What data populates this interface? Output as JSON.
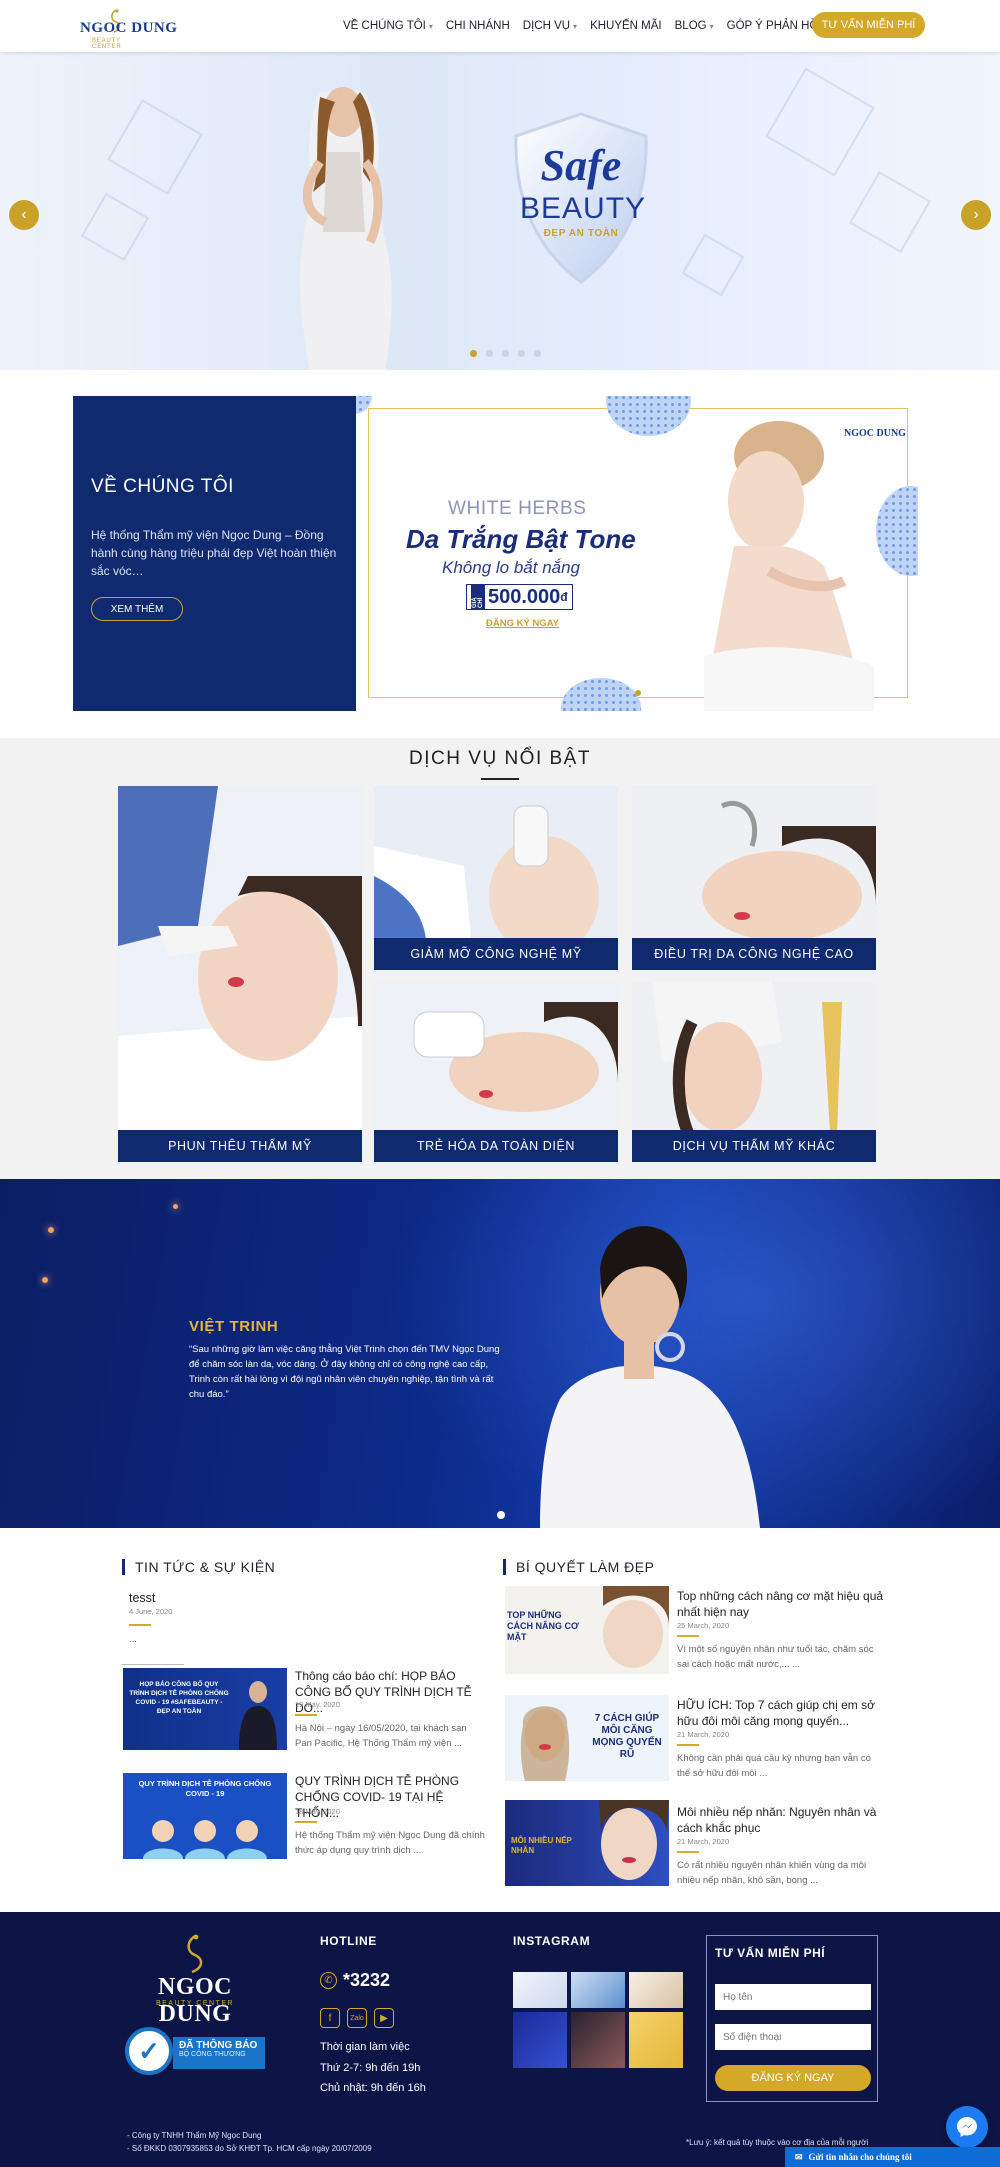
{
  "brand": {
    "logo_text": "NGOC DUNG",
    "logo_sub": "BEAUTY CENTER"
  },
  "nav": {
    "items": [
      {
        "label": "VỀ CHÚNG TÔI",
        "has_dropdown": true
      },
      {
        "label": "CHI NHÁNH",
        "has_dropdown": false
      },
      {
        "label": "DỊCH VỤ",
        "has_dropdown": true
      },
      {
        "label": "KHUYẾN MÃI",
        "has_dropdown": false
      },
      {
        "label": "BLOG",
        "has_dropdown": true
      },
      {
        "label": "GÓP Ý PHẢN HỒI",
        "has_dropdown": false
      }
    ],
    "cta": "TƯ VẤN MIỄN PHÍ"
  },
  "hero": {
    "shield_line1": "Safe",
    "shield_line2": "BEAUTY",
    "shield_line3": "ĐẸP AN TOÀN",
    "slides": 5,
    "active_slide": 1
  },
  "about": {
    "title": "VỀ CHÚNG TÔI",
    "text": "Hệ thống Thẩm mỹ viện Ngọc Dung – Đồng hành cùng hàng triệu phái đẹp Việt hoàn thiện sắc vóc…",
    "button": "XEM THÊM"
  },
  "promo": {
    "line1": "WHITE HERBS",
    "line2": "Da Trắng Bật Tone",
    "line3": "Không lo bắt nắng",
    "price_tag": "GIÁ CHỈ",
    "price": "500.000",
    "currency": "đ",
    "register": "ĐĂNG KÝ NGAY",
    "logo": "NGOC DUNG"
  },
  "services": {
    "title": "DỊCH VỤ NỔI BẬT",
    "items": [
      {
        "label": "PHUN THÊU THẨM MỸ"
      },
      {
        "label": "GIẢM MỠ CÔNG NGHỆ MỸ"
      },
      {
        "label": "ĐIỀU TRỊ DA CÔNG NGHỆ CAO"
      },
      {
        "label": "TRẺ HÓA DA TOÀN DIỆN"
      },
      {
        "label": "DỊCH VỤ THẨM MỸ KHÁC"
      }
    ]
  },
  "testimonial": {
    "name": "VIỆT TRINH",
    "quote": "“Sau những giờ làm việc căng thẳng Việt Trinh chọn đến TMV Ngọc Dung để chăm sóc làn da, vóc dáng. Ở đây không chỉ có công nghệ cao cấp, Trinh còn rất hài lòng vì đội ngũ nhân viên chuyên nghiệp, tận tình và rất chu đáo.”"
  },
  "news": {
    "title": "TIN TỨC & SỰ KIỆN",
    "first": {
      "title": "tesst",
      "date": "4 June, 2020",
      "excerpt": "..."
    },
    "posts": [
      {
        "title": "Thông cáo báo chí: HỌP BÁO CÔNG BỐ QUY TRÌNH DỊCH TỄ DO...",
        "date": "19 May, 2020",
        "excerpt": "Hà Nội – ngày 16/05/2020, tại khách sạn Pan Pacific, Hệ Thống Thẩm mỹ viện ...",
        "thumb_caption": "HỌP BÁO CÔNG BỐ QUY TRÌNH DỊCH TỄ PHÒNG CHỐNG COVID - 19 #SAFEBEAUTY - ĐẸP AN TOÀN"
      },
      {
        "title": "QUY TRÌNH DỊCH TỄ PHÒNG CHỐNG COVID- 19 TẠI HỆ THỐN...",
        "date": "18 May, 2020",
        "excerpt": "Hệ thống Thẩm mỹ viện Ngọc Dung đã chính thức áp dụng quy trình dịch ...",
        "thumb_caption": "QUY TRÌNH DỊCH TỄ PHÒNG CHỐNG COVID - 19"
      }
    ]
  },
  "tips": {
    "title": "BÍ QUYẾT LÀM ĐẸP",
    "posts": [
      {
        "title": "Top những cách nâng cơ mặt hiệu quả nhất hiện nay",
        "date": "25 March, 2020",
        "excerpt": "Vì một số nguyên nhân như tuổi tác, chăm sóc sai cách hoặc mất nước,... ...",
        "thumb_caption": "TOP NHỮNG CÁCH NÂNG CƠ MẶT"
      },
      {
        "title": "HỮU ÍCH: Top 7 cách giúp chị em sở hữu đôi môi căng mọng quyến...",
        "date": "21 March, 2020",
        "excerpt": "Không cần phải quá cầu kỳ nhưng bạn vẫn có thể sở hữu đôi môi ...",
        "thumb_caption": "7 CÁCH GIÚP MÔI CĂNG MỌNG QUYẾN RŨ"
      },
      {
        "title": "Môi nhiều nếp nhăn: Nguyên nhân và cách khắc phục",
        "date": "21 March, 2020",
        "excerpt": "Có rất nhiều nguyên nhân khiến vùng da môi nhiều nếp nhăn, khô sần, bong ...",
        "thumb_caption": "MÔI NHIỀU NẾP NHĂN"
      }
    ]
  },
  "footer": {
    "logo_text": "NGOC DUNG",
    "logo_sub": "BEAUTY CENTER",
    "badge_line1": "ĐÃ THÔNG BÁO",
    "badge_line2": "BỘ CÔNG THƯƠNG",
    "hotline_title": "HOTLINE",
    "hotline": "*3232",
    "hours_title": "Thời gian làm việc",
    "hours_weekday": "Thứ 2-7: 9h đến 19h",
    "hours_sunday": "Chủ nhật: 9h đến 16h",
    "instagram_title": "INSTAGRAM",
    "form_title": "TƯ VẤN MIỄN PHÍ",
    "form_name_placeholder": "Họ tên",
    "form_phone_placeholder": "Số điện thoại",
    "form_button": "ĐĂNG KÝ NGAY",
    "company": "- Công ty TNHH Thẩm Mỹ Ngọc Dung",
    "license": "- Số ĐKKD 0307935853 do Sở KHĐT Tp. HCM cấp ngày 20/07/2009",
    "disclaimer": "*Lưu ý: kết quả tùy thuộc vào cơ địa của mỗi người",
    "chat_label": "Gửi tin nhắn cho chúng tôi"
  },
  "colors": {
    "navy": "#0f2a6e",
    "gold": "#d4a92a",
    "footer": "#0d1547"
  },
  "icons": [
    "chevron-left-icon",
    "chevron-right-icon",
    "phone-icon",
    "facebook-icon",
    "zalo-icon",
    "youtube-icon",
    "messenger-icon",
    "mail-icon"
  ]
}
